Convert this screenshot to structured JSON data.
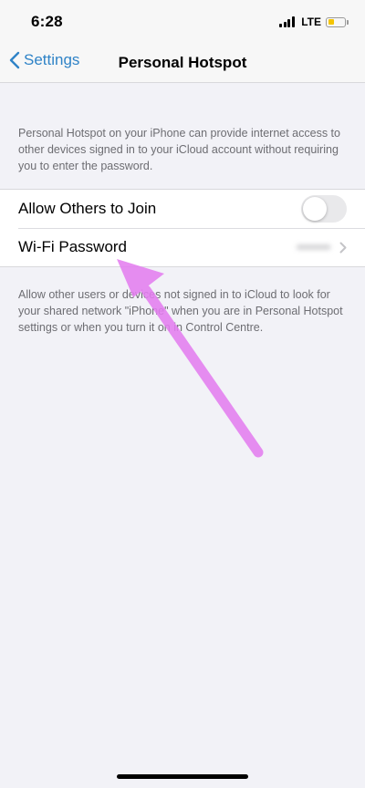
{
  "status_bar": {
    "time": "6:28",
    "network": "LTE",
    "battery_level": 0.4,
    "battery_color": "#f4c400"
  },
  "nav": {
    "back_label": "Settings",
    "title": "Personal Hotspot"
  },
  "description": "Personal Hotspot on your iPhone can provide internet access to other devices signed in to your iCloud account without requiring you to enter the password.",
  "settings": {
    "allow_join_label": "Allow Others to Join",
    "allow_join_enabled": false,
    "wifi_password_label": "Wi-Fi Password",
    "wifi_password_value": "•••••••"
  },
  "footer_note": "Allow other users or devices not signed in to iCloud to look for your shared network \"iPhone\" when you are in Personal Hotspot settings or when you turn it on in Control Centre.",
  "colors": {
    "accent": "#2f83c7",
    "annotation": "#e47ef0"
  },
  "icons": {
    "back": "chevron-left-icon",
    "disclosure": "chevron-right-icon",
    "signal": "signal-bars-icon",
    "battery": "battery-icon"
  }
}
